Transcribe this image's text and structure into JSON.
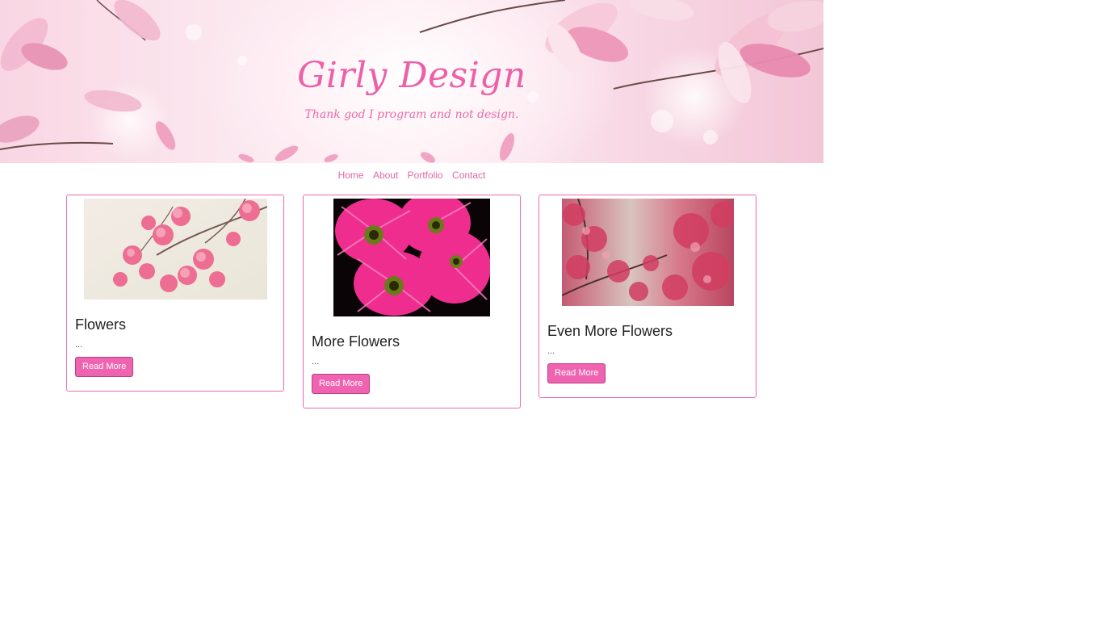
{
  "banner": {
    "title": "Girly Design",
    "tagline": "Thank god I program and not design."
  },
  "nav": {
    "items": [
      "Home",
      "About",
      "Portfolio",
      "Contact"
    ]
  },
  "cards": [
    {
      "title": "Flowers",
      "excerpt": "...",
      "button": "Read More"
    },
    {
      "title": "More Flowers",
      "excerpt": "...",
      "button": "Read More"
    },
    {
      "title": "Even More Flowers",
      "excerpt": "...",
      "button": "Read More"
    }
  ],
  "colors": {
    "accent": "#ee5fa6",
    "button": "#f063b0",
    "card_border": "#ee6aae"
  }
}
